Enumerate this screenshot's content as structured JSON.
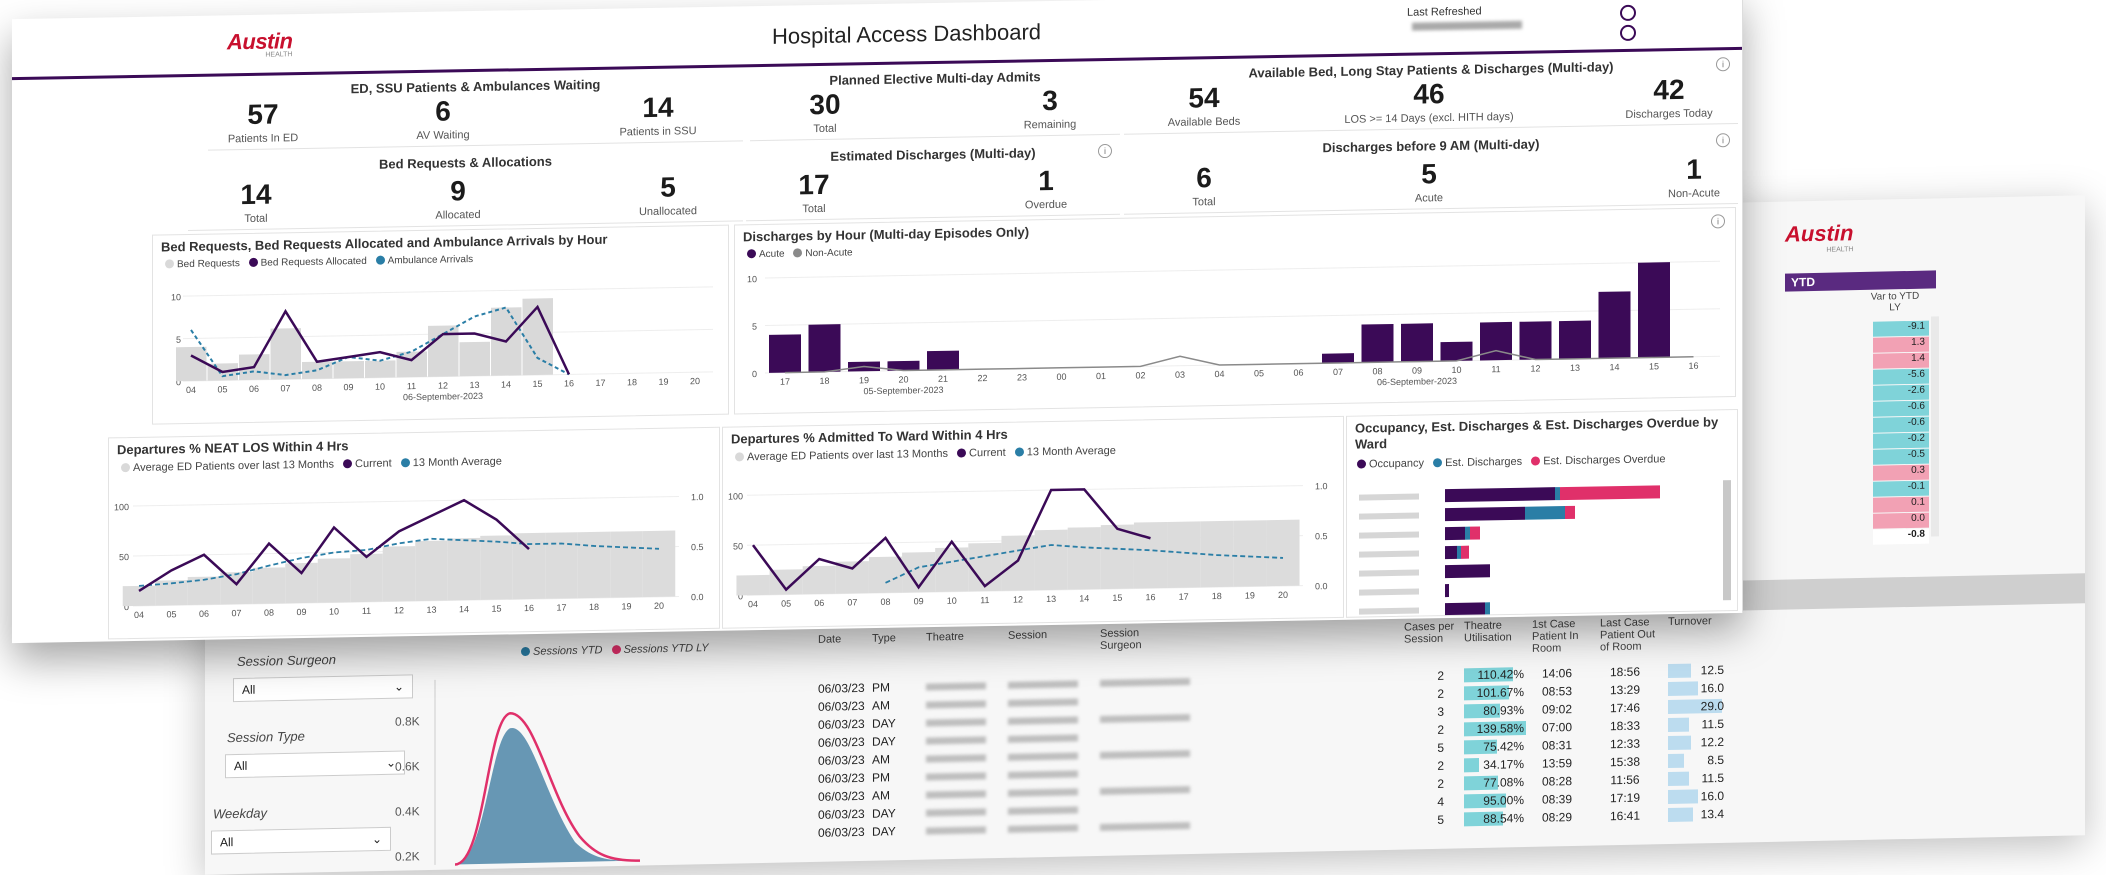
{
  "front": {
    "logo": {
      "name": "Austin",
      "sub": "HEALTH"
    },
    "title": "Hospital Access Dashboard",
    "refresh_label": "Last Refreshed",
    "kpis": {
      "ed": {
        "title": "ED, SSU Patients & Ambulances Waiting",
        "items": [
          {
            "v": "57",
            "l": "Patients In ED"
          },
          {
            "v": "6",
            "l": "AV Waiting"
          },
          {
            "v": "14",
            "l": "Patients in SSU"
          }
        ]
      },
      "elective": {
        "title": "Planned Elective Multi-day Admits",
        "items": [
          {
            "v": "30",
            "l": "Total"
          },
          {
            "v": "3",
            "l": "Remaining"
          }
        ]
      },
      "beds": {
        "title": "Available Bed, Long Stay Patients & Discharges (Multi-day)",
        "items": [
          {
            "v": "54",
            "l": "Available Beds"
          },
          {
            "v": "46",
            "l": "LOS >= 14 Days (excl. HITH days)"
          },
          {
            "v": "42",
            "l": "Discharges Today"
          }
        ]
      },
      "requests": {
        "title": "Bed Requests & Allocations",
        "items": [
          {
            "v": "14",
            "l": "Total"
          },
          {
            "v": "9",
            "l": "Allocated"
          },
          {
            "v": "5",
            "l": "Unallocated"
          }
        ]
      },
      "est": {
        "title": "Estimated Discharges (Multi-day)",
        "items": [
          {
            "v": "17",
            "l": "Total"
          },
          {
            "v": "1",
            "l": "Overdue"
          }
        ]
      },
      "nine": {
        "title": "Discharges before 9 AM (Multi-day)",
        "items": [
          {
            "v": "6",
            "l": "Total"
          },
          {
            "v": "5",
            "l": "Acute"
          },
          {
            "v": "1",
            "l": "Non-Acute"
          }
        ]
      }
    },
    "chart1": {
      "title": "Bed Requests, Bed Requests Allocated and Ambulance Arrivals by Hour",
      "legend": [
        "Bed Requests",
        "Bed Requests Allocated",
        "Ambulance Arrivals"
      ],
      "date": "06-September-2023"
    },
    "chart2": {
      "title": "Discharges by Hour (Multi-day Episodes Only)",
      "legend": [
        "Acute",
        "Non-Acute"
      ],
      "date1": "05-September-2023",
      "date2": "06-September-2023"
    },
    "chart3": {
      "title": "Departures % NEAT LOS Within 4 Hrs",
      "legend": [
        "Average ED Patients over last 13 Months",
        "Current",
        "13 Month Average"
      ]
    },
    "chart4": {
      "title": "Departures % Admitted To Ward Within 4 Hrs",
      "legend": [
        "Average ED Patients over last 13 Months",
        "Current",
        "13 Month Average"
      ]
    },
    "chart5": {
      "title": "Occupancy, Est. Discharges & Est. Discharges Overdue by Ward",
      "legend": [
        "Occupancy",
        "Est. Discharges",
        "Est. Discharges Overdue"
      ]
    }
  },
  "back": {
    "logo": {
      "name": "Austin",
      "sub": "HEALTH"
    },
    "ytd_label": "YTD",
    "var_header": "Var to YTD LY",
    "var_values": [
      "-9.1",
      "1.3",
      "1.4",
      "-5.6",
      "-2.6",
      "-0.6",
      "-0.6",
      "-0.2",
      "-0.5",
      "0.3",
      "-0.1",
      "0.1",
      "0.0",
      "-0.8"
    ],
    "slicers": [
      {
        "label": "Session Surgeon",
        "value": "All"
      },
      {
        "label": "Session Type",
        "value": "All"
      },
      {
        "label": "Weekday",
        "value": "All"
      }
    ],
    "density_legend": [
      "Sessions YTD",
      "Sessions YTD LY"
    ],
    "density_ticks": [
      "0.8K",
      "0.6K",
      "0.4K",
      "0.2K"
    ],
    "table_headers": [
      "Date",
      "Type",
      "Theatre",
      "Session",
      "Session Surgeon",
      "Cases per Session",
      "Theatre Utilisation",
      "1st Case Patient In Room",
      "Last Case Patient Out of Room",
      "Turnover"
    ],
    "rows": [
      {
        "date": "06/03/23",
        "type": "PM",
        "cases": "2",
        "util": "110.42%",
        "first": "14:06",
        "last": "18:56",
        "turn": "12.5"
      },
      {
        "date": "06/03/23",
        "type": "AM",
        "cases": "2",
        "util": "101.67%",
        "first": "08:53",
        "last": "13:29",
        "turn": "16.0"
      },
      {
        "date": "06/03/23",
        "type": "DAY",
        "cases": "3",
        "util": "80.93%",
        "first": "09:02",
        "last": "17:46",
        "turn": "29.0"
      },
      {
        "date": "06/03/23",
        "type": "DAY",
        "cases": "2",
        "util": "139.58%",
        "first": "07:00",
        "last": "18:33",
        "turn": "11.5"
      },
      {
        "date": "06/03/23",
        "type": "AM",
        "cases": "5",
        "util": "75.42%",
        "first": "08:31",
        "last": "12:33",
        "turn": "12.2"
      },
      {
        "date": "06/03/23",
        "type": "PM",
        "cases": "2",
        "util": "34.17%",
        "first": "13:59",
        "last": "15:38",
        "turn": "8.5"
      },
      {
        "date": "06/03/23",
        "type": "AM",
        "cases": "2",
        "util": "77.08%",
        "first": "08:28",
        "last": "11:56",
        "turn": "11.5"
      },
      {
        "date": "06/03/23",
        "type": "DAY",
        "cases": "4",
        "util": "95.00%",
        "first": "08:39",
        "last": "17:19",
        "turn": "16.0"
      },
      {
        "date": "06/03/23",
        "type": "DAY",
        "cases": "5",
        "util": "88.54%",
        "first": "08:29",
        "last": "16:41",
        "turn": "13.4"
      }
    ]
  },
  "colors": {
    "purple": "#3b0a57",
    "teal": "#2a7ea6",
    "pink": "#e0306a",
    "grey": "#d9d9d9",
    "brand": "#c8102e"
  }
}
